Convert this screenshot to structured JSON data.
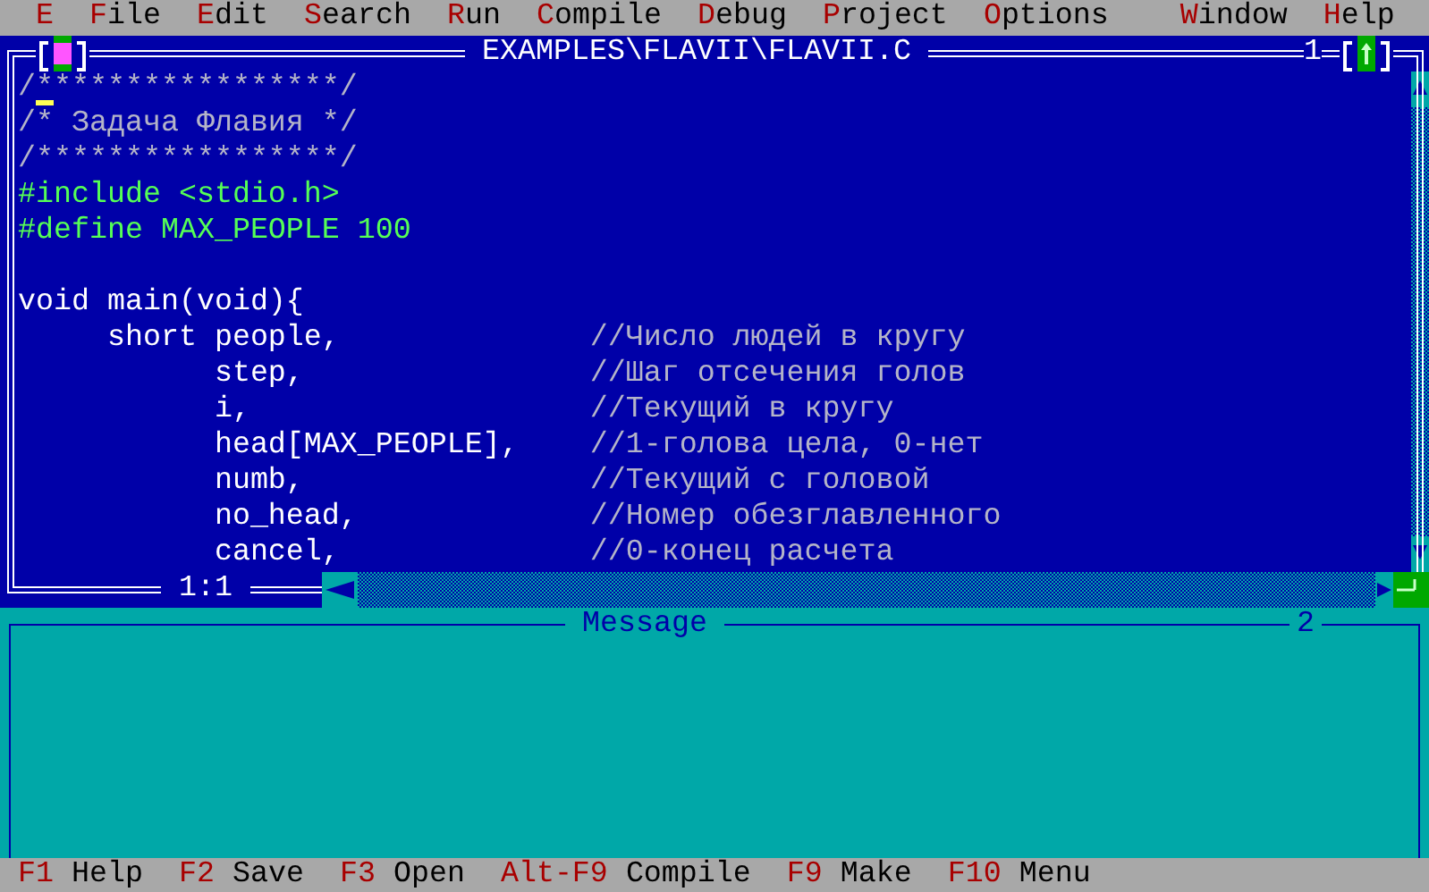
{
  "menu_bar": {
    "items": [
      {
        "label": "E"
      },
      {
        "label": "File"
      },
      {
        "label": "Edit"
      },
      {
        "label": "Search"
      },
      {
        "label": "Run"
      },
      {
        "label": "Compile"
      },
      {
        "label": "Debug"
      },
      {
        "label": "Project"
      },
      {
        "label": "Options"
      },
      {
        "label": "Window",
        "kind": "spaced"
      },
      {
        "label": "Help"
      }
    ]
  },
  "editor": {
    "title": "EXAMPLES\\FLAVII\\FLAVII.C",
    "window_number": "1",
    "position": "1:1",
    "lines": [
      {
        "kind": "comment",
        "text": "/*****************/",
        "cursor": true
      },
      {
        "kind": "comment",
        "text": "/* Задача Флавия */",
        "cursor": false
      },
      {
        "kind": "comment",
        "text": "/*****************/",
        "cursor": false
      },
      {
        "kind": "directive",
        "text": "#include <stdio.h>",
        "cursor": false
      },
      {
        "kind": "directive",
        "text": "#define MAX_PEOPLE 100",
        "cursor": false
      },
      {
        "kind": "blank",
        "cursor": false
      },
      {
        "kind": "code",
        "text": "void main(void){",
        "cursor": false
      },
      {
        "kind": "code",
        "text": "     short people,",
        "comment": "//Число людей в кругу",
        "cursor": false
      },
      {
        "kind": "code",
        "text": "           step,",
        "comment": "//Шаг отсечения голов",
        "cursor": false
      },
      {
        "kind": "code",
        "text": "           i,",
        "comment": "//Текущий в кругу",
        "cursor": false
      },
      {
        "kind": "code",
        "text": "           head[MAX_PEOPLE],",
        "comment": "//1-голова цела, 0-нет",
        "cursor": false
      },
      {
        "kind": "code",
        "text": "           numb,",
        "comment": "//Текущий с головой",
        "cursor": false
      },
      {
        "kind": "code",
        "text": "           no_head,",
        "comment": "//Номер обезглавленного",
        "cursor": false
      },
      {
        "kind": "code",
        "text": "           cancel,",
        "comment": "//0-конец расчета",
        "cursor": false
      }
    ]
  },
  "message_window": {
    "title": "Message",
    "window_number": "2"
  },
  "status_bar": {
    "items": [
      {
        "key": "F1",
        "label": "Help"
      },
      {
        "key": "F2",
        "label": "Save"
      },
      {
        "key": "F3",
        "label": "Open"
      },
      {
        "key": "Alt-F9",
        "label": "Compile"
      },
      {
        "key": "F9",
        "label": "Make"
      },
      {
        "key": "F10",
        "label": "Menu"
      }
    ]
  }
}
